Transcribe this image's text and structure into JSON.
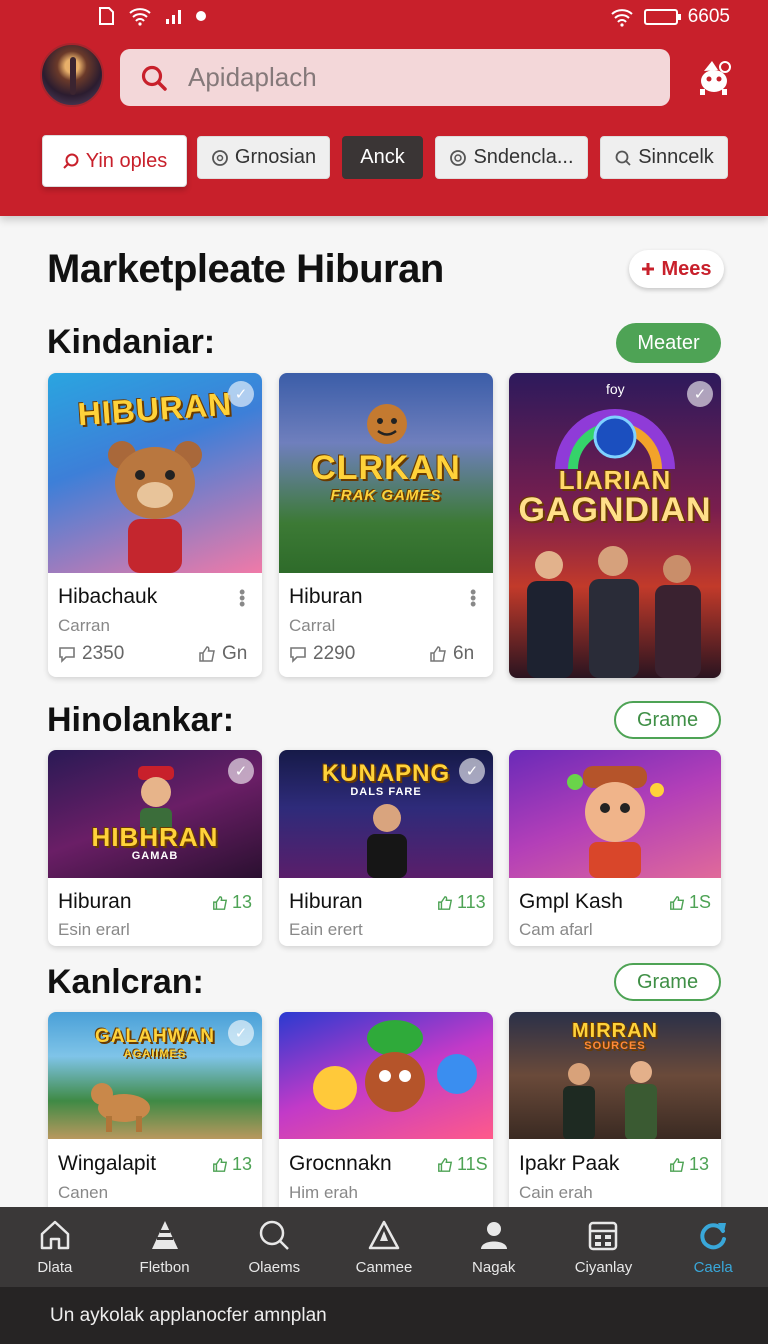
{
  "status_bar": {
    "battery_text": "6605"
  },
  "header": {
    "search_placeholder": "Apidaplach",
    "chips": [
      {
        "label": "Yin oples",
        "icon": "search-icon"
      },
      {
        "label": "Grnosian",
        "icon": "chat-icon"
      },
      {
        "label": "Anck",
        "icon": ""
      },
      {
        "label": "Sndencla...",
        "icon": "target-icon"
      },
      {
        "label": "Sinncelk",
        "icon": "search-icon"
      }
    ]
  },
  "page": {
    "title": "Marketpleate Hiburan",
    "more_label": "Mees"
  },
  "sections": [
    {
      "title": "Kindaniar:",
      "action_label": "Meater",
      "cards": [
        {
          "thumb_text": "HIBURAN",
          "title": "Hibachauk",
          "subtitle": "Carran",
          "views": "2350",
          "likes": "Gn"
        },
        {
          "thumb_text": "CLRKAN",
          "thumb_text2": "FRAK GAMES",
          "title": "Hiburan",
          "subtitle": "Carral",
          "views": "2290",
          "likes": "6n"
        },
        {
          "thumb_text": "LIARIAN",
          "thumb_text2": "GAGNDIAN",
          "thumb_small": "foy"
        }
      ]
    },
    {
      "title": "Hinolankar:",
      "action_label": "Grame",
      "cards": [
        {
          "thumb_text": "HIBHRAN",
          "thumb_text2": "GAMAB",
          "title": "Hiburan",
          "subtitle": "Esin erarl",
          "likes": "13"
        },
        {
          "thumb_text": "KUNAPNG",
          "thumb_text2": "DALS FARE",
          "title": "Hiburan",
          "subtitle": "Eain erert",
          "likes": "113"
        },
        {
          "title": "Gmpl Kash",
          "subtitle": "Cam afarl",
          "likes": "1S"
        }
      ]
    },
    {
      "title": "Kanlcran:",
      "action_label": "Grame",
      "cards": [
        {
          "thumb_text": "GALAHWAN",
          "thumb_text2": "AGAIIMES",
          "title": "Wingalapit",
          "subtitle": "Canen",
          "likes": "13"
        },
        {
          "title": "Grocnnakn",
          "subtitle": "Him erah",
          "likes": "11S"
        },
        {
          "thumb_text": "MIRRAN",
          "thumb_text2": "SOURCES",
          "title": "Ipakr Paak",
          "subtitle": "Cain erah",
          "likes": "13"
        }
      ]
    }
  ],
  "bottom_nav": [
    {
      "label": "Dlata",
      "icon": "home-icon"
    },
    {
      "label": "Fletbon",
      "icon": "cone-icon"
    },
    {
      "label": "Olaems",
      "icon": "search-icon"
    },
    {
      "label": "Canmee",
      "icon": "warning-icon"
    },
    {
      "label": "Nagak",
      "icon": "user-icon"
    },
    {
      "label": "Ciyanlay",
      "icon": "calendar-icon"
    },
    {
      "label": "Caela",
      "icon": "refresh-icon",
      "active": true
    }
  ],
  "footer": {
    "text": "Un aykolak applanocfer amnplan"
  },
  "colors": {
    "brand": "#c8202b",
    "accent_green": "#4ea355",
    "nav_active": "#39a7d9"
  }
}
